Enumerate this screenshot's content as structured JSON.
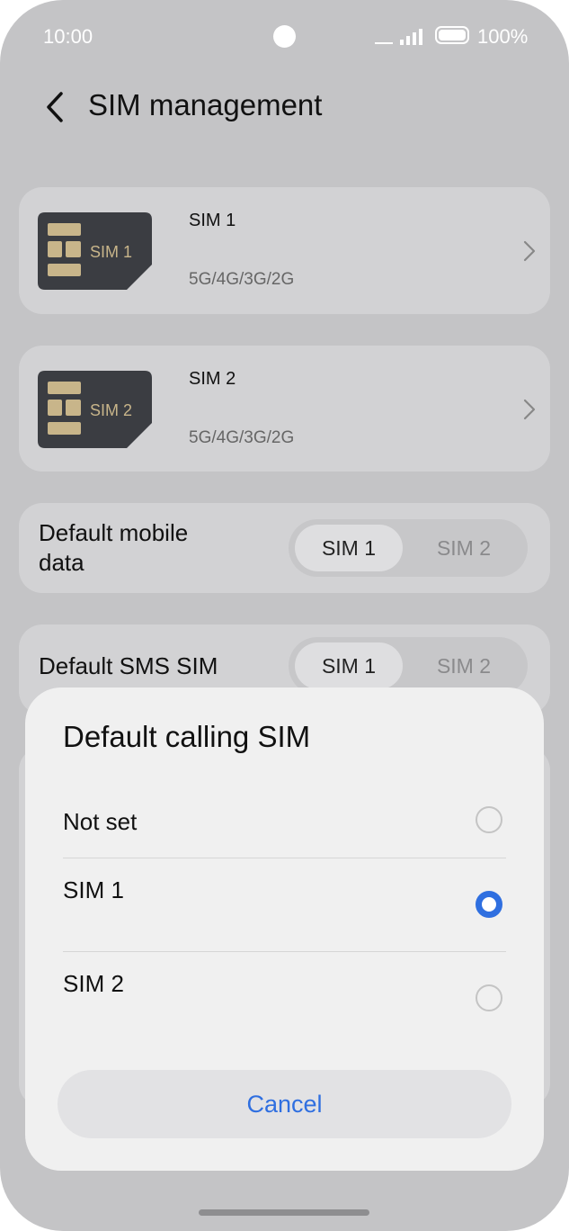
{
  "status_bar": {
    "time": "10:00",
    "battery": "100%"
  },
  "header": {
    "title": "SIM management"
  },
  "sims": [
    {
      "name": "SIM 1",
      "card_label": "SIM 1",
      "networks": "5G/4G/3G/2G"
    },
    {
      "name": "SIM 2",
      "card_label": "SIM 2",
      "networks": "5G/4G/3G/2G"
    }
  ],
  "default_mobile_data": {
    "label_line1": "Default mobile",
    "label_line2": "data",
    "options": [
      "SIM 1",
      "SIM 2"
    ],
    "selected": "SIM 1"
  },
  "default_sms": {
    "label": "Default SMS SIM",
    "options": [
      "SIM 1",
      "SIM 2"
    ],
    "selected": "SIM 1"
  },
  "dialog": {
    "title": "Default calling SIM",
    "options": [
      {
        "label": "Not set",
        "selected": false
      },
      {
        "label": "SIM 1",
        "selected": true
      },
      {
        "label": "SIM 2",
        "selected": false
      }
    ],
    "cancel_label": "Cancel"
  },
  "colors": {
    "accent": "#2f6fe0",
    "card_chip": "#c8b58a",
    "card_body": "#3b3d42"
  }
}
